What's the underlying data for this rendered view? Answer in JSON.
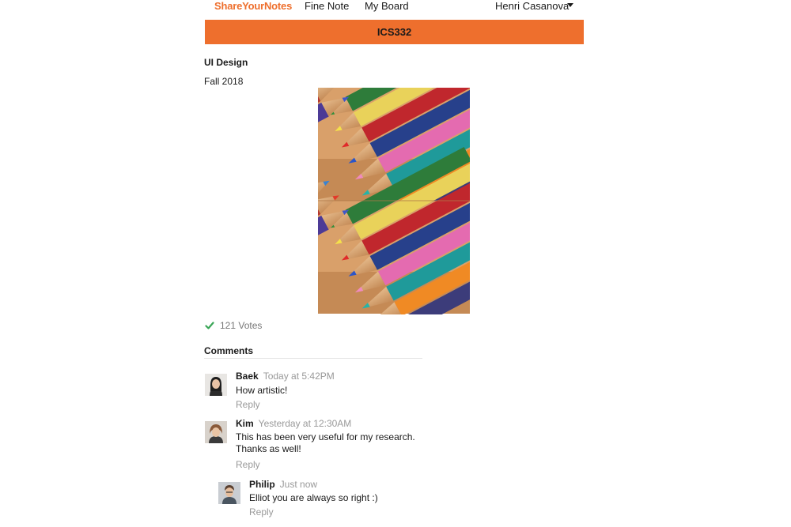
{
  "nav": {
    "brand": "ShareYourNotes",
    "links": [
      "Fine Note",
      "My Board"
    ],
    "user": "Henri Casanova",
    "user_menu_icon": "caret-down-icon"
  },
  "course": {
    "code": "ICS332"
  },
  "note": {
    "title": "UI Design",
    "term": "Fall 2018",
    "image_icon": "pencils-image"
  },
  "votes": {
    "icon": "check-icon",
    "label": "121 Votes",
    "icon_color": "#3aa657"
  },
  "comments": {
    "heading": "Comments",
    "items": [
      {
        "author": "Baek",
        "time": "Today at 5:42PM",
        "text": [
          "How artistic!"
        ],
        "reply": "Reply"
      },
      {
        "author": "Kim",
        "time": "Yesterday at 12:30AM",
        "text": [
          "This has been very useful for my research.",
          "Thanks as well!"
        ],
        "reply": "Reply"
      },
      {
        "author": "Philip",
        "time": "Just now",
        "text": [
          "Elliot you are always so right :)"
        ],
        "reply": "Reply"
      }
    ]
  },
  "colors": {
    "accent": "#ee6f2d",
    "muted": "#999999"
  }
}
